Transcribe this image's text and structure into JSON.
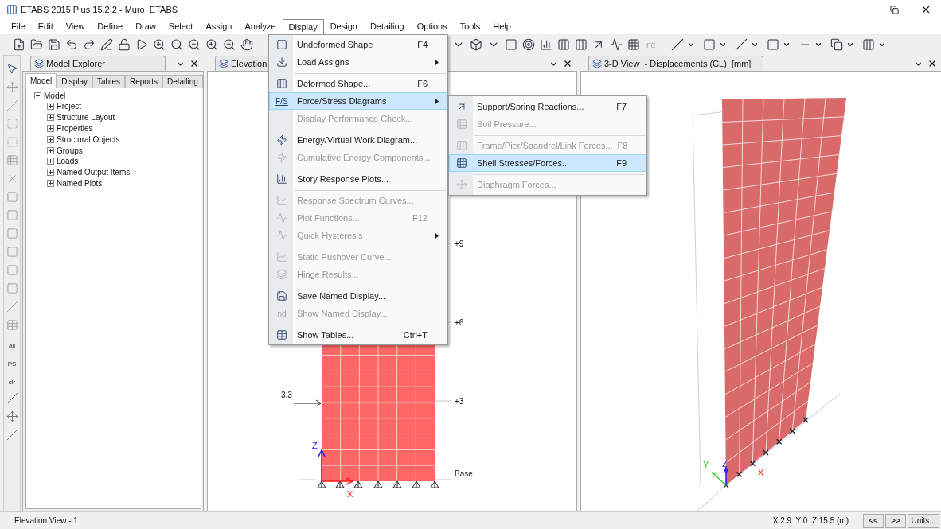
{
  "window": {
    "title": "ETABS 2015 Plus 15.2.2 - Muro_ETABS"
  },
  "menu_bar": [
    {
      "label": "File",
      "selected": false
    },
    {
      "label": "Edit",
      "selected": false
    },
    {
      "label": "View",
      "selected": false
    },
    {
      "label": "Define",
      "selected": false
    },
    {
      "label": "Draw",
      "selected": false
    },
    {
      "label": "Select",
      "selected": false
    },
    {
      "label": "Assign",
      "selected": false
    },
    {
      "label": "Analyze",
      "selected": false
    },
    {
      "label": "Display",
      "selected": true
    },
    {
      "label": "Design",
      "selected": false
    },
    {
      "label": "Detailing",
      "selected": false
    },
    {
      "label": "Options",
      "selected": false
    },
    {
      "label": "Tools",
      "selected": false
    },
    {
      "label": "Help",
      "selected": false
    }
  ],
  "toolbar": {
    "named_display_label": "nd"
  },
  "left_toolbar": {
    "labels": [
      "all",
      "PS",
      "clr"
    ]
  },
  "display_menu": [
    {
      "label": "Undeformed Shape",
      "shortcut": "F4",
      "submenu": false,
      "disabled": false,
      "highlighted": false,
      "separator_before": false
    },
    {
      "label": "Load Assigns",
      "submenu": true,
      "disabled": false,
      "highlighted": false,
      "separator_before": false
    },
    {
      "label": "Deformed Shape...",
      "shortcut": "F6",
      "submenu": false,
      "disabled": false,
      "highlighted": false,
      "separator_before": true
    },
    {
      "label": "Force/Stress Diagrams",
      "icon_text": "F/S",
      "submenu": true,
      "disabled": false,
      "highlighted": true,
      "separator_before": false
    },
    {
      "label": "Display Performance Check...",
      "submenu": false,
      "disabled": true,
      "highlighted": false,
      "separator_before": false
    },
    {
      "label": "Energy/Virtual Work Diagram...",
      "submenu": false,
      "disabled": false,
      "highlighted": false,
      "separator_before": true
    },
    {
      "label": "Cumulative Energy Components...",
      "submenu": false,
      "disabled": true,
      "highlighted": false,
      "separator_before": false
    },
    {
      "label": "Story Response Plots...",
      "submenu": false,
      "disabled": false,
      "highlighted": false,
      "separator_before": true
    },
    {
      "label": "Response Spectrum Curves...",
      "submenu": false,
      "disabled": true,
      "highlighted": false,
      "separator_before": true
    },
    {
      "label": "Plot Functions...",
      "shortcut": "F12",
      "submenu": false,
      "disabled": true,
      "highlighted": false,
      "separator_before": false
    },
    {
      "label": "Quick Hysteresis",
      "submenu": true,
      "disabled": true,
      "highlighted": false,
      "separator_before": false
    },
    {
      "label": "Static Pushover Curve...",
      "submenu": false,
      "disabled": true,
      "highlighted": false,
      "separator_before": true
    },
    {
      "label": "Hinge Results...",
      "submenu": false,
      "disabled": true,
      "highlighted": false,
      "separator_before": false
    },
    {
      "label": "Save Named Display...",
      "submenu": false,
      "disabled": false,
      "highlighted": false,
      "separator_before": true
    },
    {
      "label": "Show Named Display...",
      "icon_text": "nd",
      "submenu": false,
      "disabled": true,
      "highlighted": false,
      "separator_before": false
    },
    {
      "label": "Show Tables...",
      "shortcut": "Ctrl+T",
      "submenu": false,
      "disabled": false,
      "highlighted": false,
      "separator_before": true
    }
  ],
  "force_stress_submenu": [
    {
      "label": "Support/Spring Reactions...",
      "shortcut": "F7",
      "disabled": false,
      "highlighted": false,
      "separator_before": false
    },
    {
      "label": "Soil Pressure...",
      "disabled": true,
      "highlighted": false,
      "separator_before": false
    },
    {
      "label": "Frame/Pier/Spandrel/Link Forces...",
      "shortcut": "F8",
      "disabled": true,
      "highlighted": false,
      "separator_before": true
    },
    {
      "label": "Shell Stresses/Forces...",
      "shortcut": "F9",
      "disabled": false,
      "highlighted": true,
      "separator_before": false
    },
    {
      "label": "Diaphragm Forces...",
      "disabled": true,
      "highlighted": false,
      "separator_before": true
    }
  ],
  "model_explorer": {
    "title": "Model Explorer",
    "tabs": [
      {
        "label": "Model",
        "selected": true
      },
      {
        "label": "Display",
        "selected": false
      },
      {
        "label": "Tables",
        "selected": false
      },
      {
        "label": "Reports",
        "selected": false
      },
      {
        "label": "Detailing",
        "selected": false
      }
    ],
    "tree": [
      {
        "label": "Model",
        "expanded": true,
        "children": [
          {
            "label": "Project",
            "expanded": false
          },
          {
            "label": "Structure Layout",
            "expanded": false
          },
          {
            "label": "Properties",
            "expanded": false
          },
          {
            "label": "Structural Objects",
            "expanded": false
          },
          {
            "label": "Groups",
            "expanded": false
          },
          {
            "label": "Loads",
            "expanded": false
          },
          {
            "label": "Named Output Items",
            "expanded": false
          },
          {
            "label": "Named Plots",
            "expanded": false
          }
        ]
      }
    ]
  },
  "elevation_view": {
    "tab": "Elevation",
    "story_labels": [
      "+9",
      "+6",
      "+3",
      "Base"
    ],
    "load_value": "3.3",
    "axis_z": "Z",
    "axis_x": "X"
  },
  "three_d_view": {
    "tab": "3-D View  - Displacements (CL)  [mm]",
    "axis_x": "X",
    "axis_y": "Y",
    "axis_z": "Z"
  },
  "status_bar": {
    "view": "Elevation View - 1",
    "coordinates": "X 2.9  Y 0  Z 15.5 (m)",
    "buttons": [
      "<<",
      ">>",
      "Units..."
    ]
  }
}
